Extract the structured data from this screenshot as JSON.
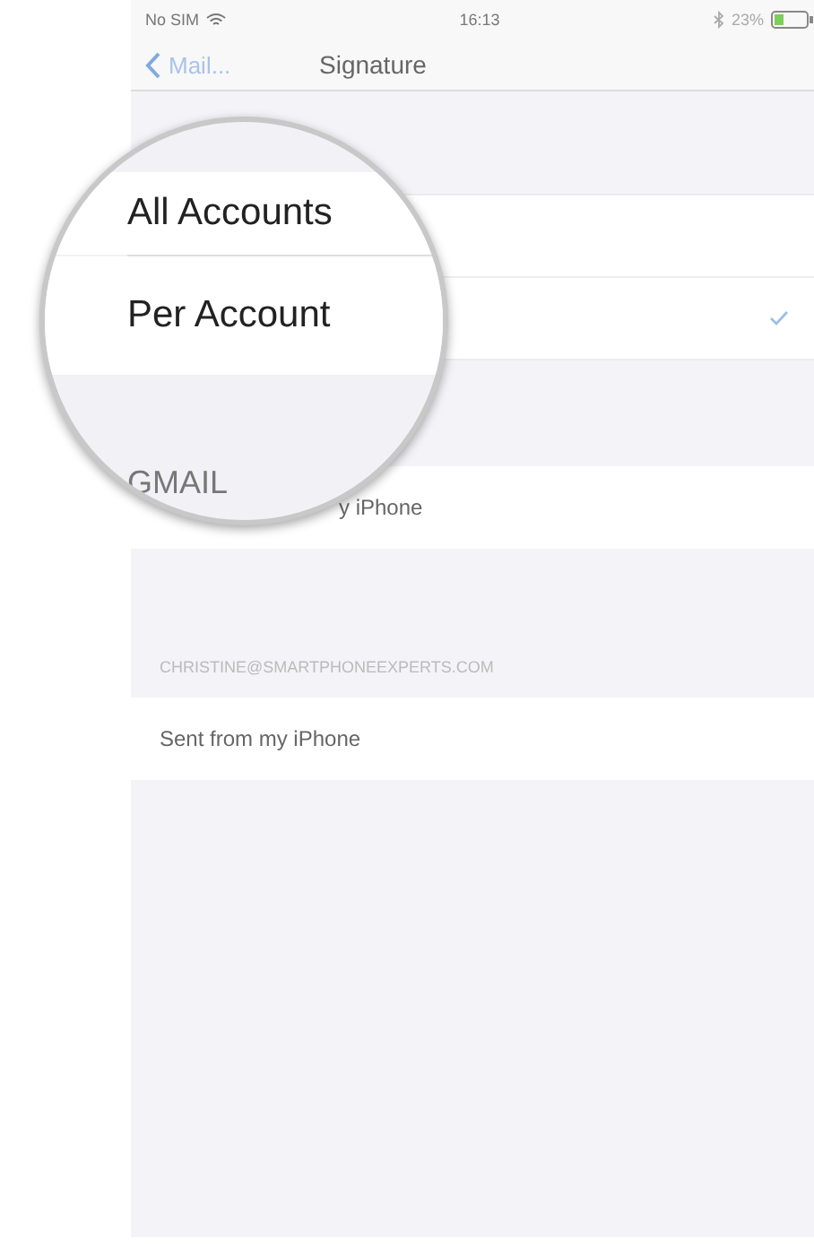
{
  "status_bar": {
    "carrier": "No SIM",
    "time": "16:13",
    "battery": "23%"
  },
  "nav_bar": {
    "back": "Mail...",
    "title": "Signature"
  },
  "options": [
    {
      "label": "All Accounts",
      "selected": false
    },
    {
      "label": "Per Account",
      "selected": true
    }
  ],
  "magnifier": {
    "header": "GMAIL"
  },
  "sections": [
    {
      "signature": "y iPhone"
    },
    {
      "header": "CHRISTINE@SMARTPHONEEXPERTS.COM",
      "signature": "Sent from my iPhone"
    }
  ]
}
